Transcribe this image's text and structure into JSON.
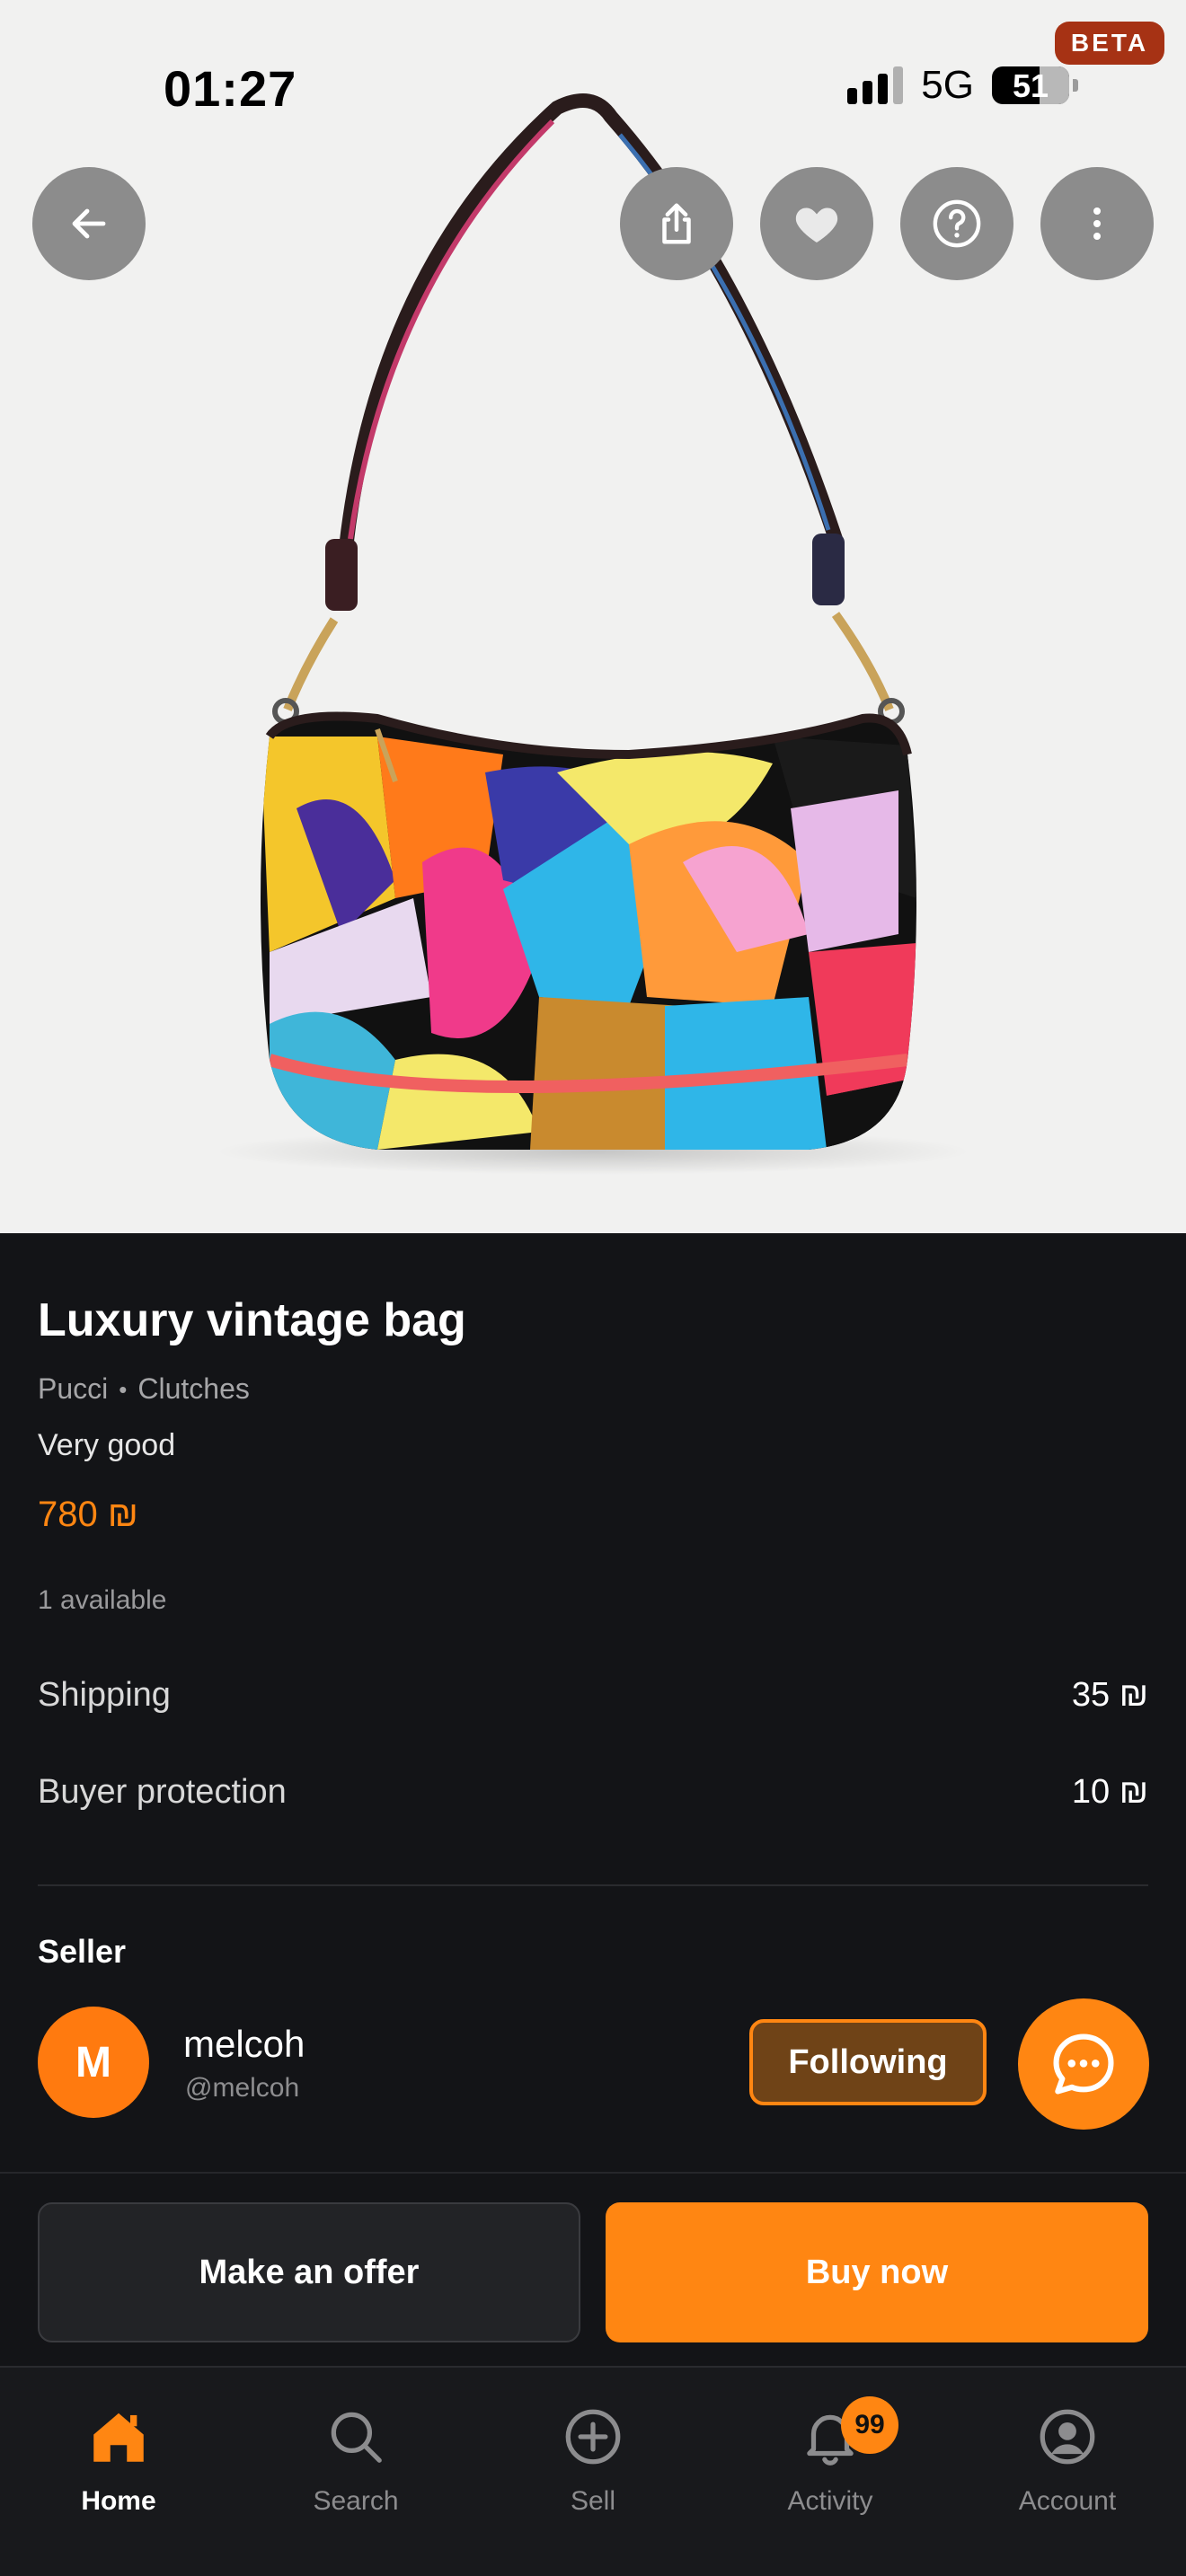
{
  "status_bar": {
    "time": "01:27",
    "network": "5G",
    "battery": "51"
  },
  "beta_badge": "BETA",
  "product": {
    "title": "Luxury vintage bag",
    "brand": "Pucci",
    "category": "Clutches",
    "condition": "Very good",
    "price": "780 ₪",
    "available": "1 available"
  },
  "fees": {
    "shipping_label": "Shipping",
    "shipping_value": "35 ₪",
    "protection_label": "Buyer protection",
    "protection_value": "10 ₪"
  },
  "seller": {
    "heading": "Seller",
    "avatar_initial": "M",
    "name": "melcoh",
    "handle": "@melcoh",
    "follow_label": "Following"
  },
  "actions": {
    "offer_label": "Make an offer",
    "buy_label": "Buy now"
  },
  "tabbar": {
    "items": [
      {
        "label": "Home",
        "icon": "home-icon"
      },
      {
        "label": "Search",
        "icon": "search-icon"
      },
      {
        "label": "Sell",
        "icon": "plus-circle-icon"
      },
      {
        "label": "Activity",
        "icon": "bell-icon"
      },
      {
        "label": "Account",
        "icon": "user-circle-icon"
      }
    ],
    "activity_badge": "99"
  },
  "colors": {
    "accent": "#ff8612",
    "background": "#131417",
    "beta": "#a63214"
  }
}
